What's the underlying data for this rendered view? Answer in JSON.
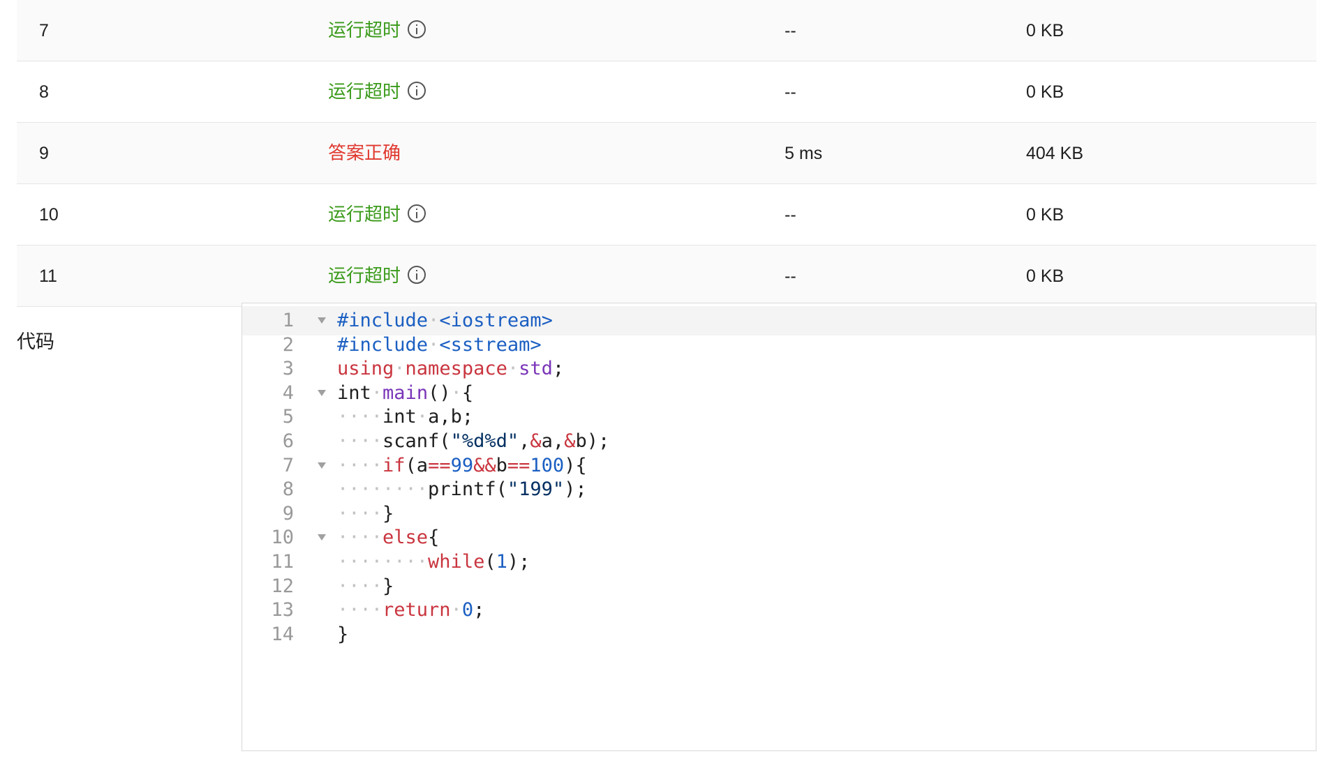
{
  "results": {
    "rows": [
      {
        "id": "7",
        "status": "运行超时",
        "status_type": "tle",
        "time": "--",
        "memory": "0 KB"
      },
      {
        "id": "8",
        "status": "运行超时",
        "status_type": "tle",
        "time": "--",
        "memory": "0 KB"
      },
      {
        "id": "9",
        "status": "答案正确",
        "status_type": "ac",
        "time": "5 ms",
        "memory": "404 KB"
      },
      {
        "id": "10",
        "status": "运行超时",
        "status_type": "tle",
        "time": "--",
        "memory": "0 KB"
      },
      {
        "id": "11",
        "status": "运行超时",
        "status_type": "tle",
        "time": "--",
        "memory": "0 KB"
      }
    ]
  },
  "code": {
    "label": "代码",
    "lines": [
      {
        "n": "1",
        "fold": true,
        "tokens": [
          {
            "t": "#include",
            "c": "pre"
          },
          {
            "t": "·",
            "c": "ws"
          },
          {
            "t": "<iostream>",
            "c": "pre"
          }
        ]
      },
      {
        "n": "2",
        "fold": false,
        "tokens": [
          {
            "t": "#include",
            "c": "pre"
          },
          {
            "t": "·",
            "c": "ws"
          },
          {
            "t": "<sstream>",
            "c": "pre"
          }
        ]
      },
      {
        "n": "3",
        "fold": false,
        "tokens": [
          {
            "t": "using",
            "c": "kw"
          },
          {
            "t": "·",
            "c": "ws"
          },
          {
            "t": "namespace",
            "c": "kw"
          },
          {
            "t": "·",
            "c": "ws"
          },
          {
            "t": "std",
            "c": "fn"
          },
          {
            "t": ";",
            "c": ""
          }
        ]
      },
      {
        "n": "4",
        "fold": true,
        "tokens": [
          {
            "t": "int",
            "c": ""
          },
          {
            "t": "·",
            "c": "ws"
          },
          {
            "t": "main",
            "c": "fn"
          },
          {
            "t": "()",
            "c": ""
          },
          {
            "t": "·",
            "c": "ws"
          },
          {
            "t": "{",
            "c": ""
          }
        ]
      },
      {
        "n": "5",
        "fold": false,
        "tokens": [
          {
            "t": "····",
            "c": "ws"
          },
          {
            "t": "int",
            "c": ""
          },
          {
            "t": "·",
            "c": "ws"
          },
          {
            "t": "a,b;",
            "c": ""
          }
        ]
      },
      {
        "n": "6",
        "fold": false,
        "tokens": [
          {
            "t": "····",
            "c": "ws"
          },
          {
            "t": "scanf(",
            "c": ""
          },
          {
            "t": "\"%d%d\"",
            "c": "str"
          },
          {
            "t": ",",
            "c": ""
          },
          {
            "t": "&",
            "c": "kw"
          },
          {
            "t": "a,",
            "c": ""
          },
          {
            "t": "&",
            "c": "kw"
          },
          {
            "t": "b);",
            "c": ""
          }
        ]
      },
      {
        "n": "7",
        "fold": true,
        "tokens": [
          {
            "t": "····",
            "c": "ws"
          },
          {
            "t": "if",
            "c": "kw"
          },
          {
            "t": "(a",
            "c": ""
          },
          {
            "t": "==",
            "c": "kw"
          },
          {
            "t": "99",
            "c": "num"
          },
          {
            "t": "&&",
            "c": "kw"
          },
          {
            "t": "b",
            "c": ""
          },
          {
            "t": "==",
            "c": "kw"
          },
          {
            "t": "100",
            "c": "num"
          },
          {
            "t": "){",
            "c": ""
          }
        ]
      },
      {
        "n": "8",
        "fold": false,
        "tokens": [
          {
            "t": "········",
            "c": "ws"
          },
          {
            "t": "printf(",
            "c": ""
          },
          {
            "t": "\"199\"",
            "c": "str"
          },
          {
            "t": ");",
            "c": ""
          }
        ]
      },
      {
        "n": "9",
        "fold": false,
        "tokens": [
          {
            "t": "····",
            "c": "ws"
          },
          {
            "t": "}",
            "c": ""
          }
        ]
      },
      {
        "n": "10",
        "fold": true,
        "tokens": [
          {
            "t": "····",
            "c": "ws"
          },
          {
            "t": "else",
            "c": "kw"
          },
          {
            "t": "{",
            "c": ""
          }
        ]
      },
      {
        "n": "11",
        "fold": false,
        "tokens": [
          {
            "t": "········",
            "c": "ws"
          },
          {
            "t": "while",
            "c": "kw"
          },
          {
            "t": "(",
            "c": ""
          },
          {
            "t": "1",
            "c": "num"
          },
          {
            "t": ");",
            "c": ""
          }
        ]
      },
      {
        "n": "12",
        "fold": false,
        "tokens": [
          {
            "t": "····",
            "c": "ws"
          },
          {
            "t": "}",
            "c": ""
          }
        ]
      },
      {
        "n": "13",
        "fold": false,
        "tokens": [
          {
            "t": "····",
            "c": "ws"
          },
          {
            "t": "return",
            "c": "kw"
          },
          {
            "t": "·",
            "c": "ws"
          },
          {
            "t": "0",
            "c": "num"
          },
          {
            "t": ";",
            "c": ""
          }
        ]
      },
      {
        "n": "14",
        "fold": false,
        "tokens": [
          {
            "t": "}",
            "c": ""
          }
        ]
      }
    ]
  },
  "colors": {
    "tle": "#3a9a1a",
    "ac": "#e0382f"
  },
  "icons": {
    "status_info": "info-circle-icon",
    "fold": "fold-arrow-icon"
  }
}
